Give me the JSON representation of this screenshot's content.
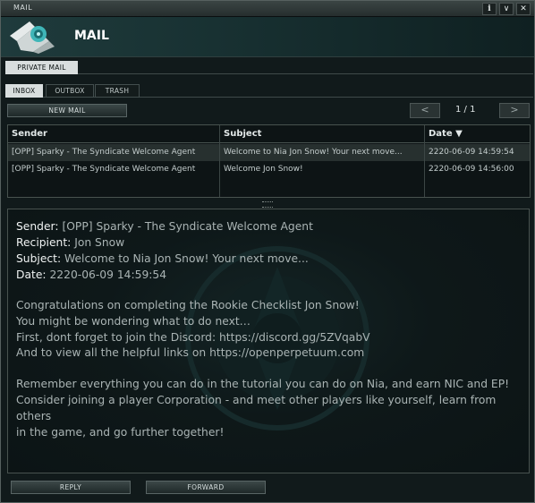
{
  "window": {
    "title": "MAIL",
    "header_title": "MAIL",
    "controls": [
      {
        "name": "info-icon",
        "glyph": "i"
      },
      {
        "name": "minimize-icon",
        "glyph": "∨"
      },
      {
        "name": "close-icon",
        "glyph": "✕"
      }
    ]
  },
  "folder_tabs": [
    {
      "label": "PRIVATE MAIL",
      "active": true
    }
  ],
  "mailbox_tabs": [
    {
      "label": "INBOX",
      "active": true
    },
    {
      "label": "OUTBOX",
      "active": false
    },
    {
      "label": "TRASH",
      "active": false
    }
  ],
  "toolbar": {
    "new_mail_label": "NEW MAIL",
    "prev_glyph": "<",
    "next_glyph": ">",
    "page_indicator": "1 / 1"
  },
  "table": {
    "columns": [
      "Sender",
      "Subject",
      "Date ▼"
    ],
    "rows": [
      {
        "sender": "[OPP] Sparky - The Syndicate Welcome Agent",
        "subject": "Welcome to Nia Jon Snow! Your next move...",
        "date": "2220-06-09 14:59:54",
        "selected": true
      },
      {
        "sender": "[OPP] Sparky - The Syndicate Welcome Agent",
        "subject": "Welcome Jon Snow!",
        "date": "2220-06-09 14:56:00",
        "selected": false
      }
    ]
  },
  "message": {
    "sender_label": "Sender:",
    "sender_value": "[OPP] Sparky - The Syndicate Welcome Agent",
    "recipient_label": "Recipient:",
    "recipient_value": "Jon Snow",
    "subject_label": "Subject:",
    "subject_value": "Welcome to Nia Jon Snow! Your next move...",
    "date_label": "Date:",
    "date_value": "2220-06-09 14:59:54",
    "paragraphs": [
      "Congratulations on completing the Rookie Checklist Jon Snow!\nYou might be wondering what to do next…\nFirst, dont forget to join the Discord:  https://discord.gg/5ZVqabV\nAnd to view all the helpful links on https://openperpetuum.com",
      "Remember everything you can do in the tutorial you can do on Nia, and earn NIC and EP!\nConsider joining a player Corporation - and meet other players like yourself, learn from others\nin the game, and go further together!"
    ]
  },
  "actions": {
    "reply_label": "REPLY",
    "forward_label": "FORWARD"
  },
  "colors": {
    "accent": "#1f3b3c",
    "active_tab": "#d9dede",
    "selected_row": "#27302f"
  }
}
